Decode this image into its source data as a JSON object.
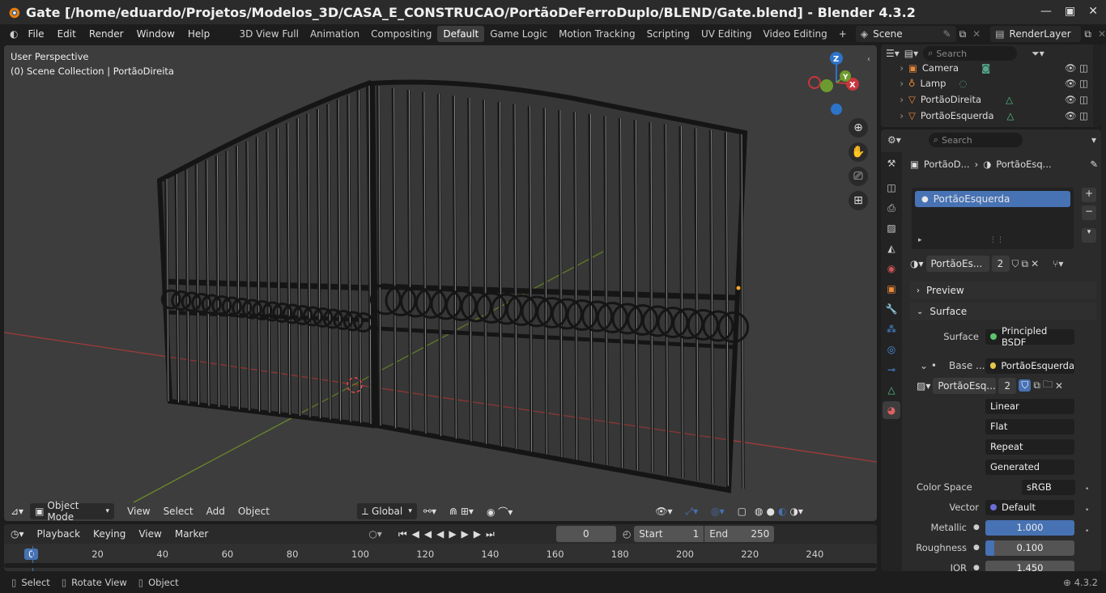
{
  "window": {
    "title": "Gate [/home/eduardo/Projetos/Modelos_3D/CASA_E_CONSTRUCAO/PortãoDeFerroDuplo/BLEND/Gate.blend] - Blender 4.3.2"
  },
  "menus": [
    "File",
    "Edit",
    "Render",
    "Window",
    "Help"
  ],
  "workspaces": [
    "3D View Full",
    "Animation",
    "Compositing",
    "Default",
    "Game Logic",
    "Motion Tracking",
    "Scripting",
    "UV Editing",
    "Video Editing"
  ],
  "active_workspace": "Default",
  "scene": {
    "name": "Scene",
    "render_layer": "RenderLayer"
  },
  "viewport": {
    "perspective": "User Perspective",
    "collection": "(0) Scene Collection | PortãoDireita",
    "gizmo_axes": {
      "x": "X",
      "y": "Y",
      "z": "Z"
    }
  },
  "viewport_header": {
    "mode": "Object Mode",
    "menus": [
      "View",
      "Select",
      "Add",
      "Object"
    ],
    "orientation": "Global"
  },
  "timeline": {
    "menus": [
      "Playback",
      "Keying",
      "View",
      "Marker"
    ],
    "current_frame": "0",
    "start_label": "Start",
    "start": "1",
    "end_label": "End",
    "end": "250",
    "ticks": [
      "0",
      "20",
      "40",
      "60",
      "80",
      "100",
      "120",
      "140",
      "160",
      "180",
      "200",
      "220",
      "240"
    ]
  },
  "status": {
    "select": "Select",
    "rotate": "Rotate View",
    "object": "Object",
    "version": "4.3.2"
  },
  "outliner": {
    "search_placeholder": "Search",
    "items": [
      {
        "name": "Camera"
      },
      {
        "name": "Lamp"
      },
      {
        "name": "PortãoDireita"
      },
      {
        "name": "PortãoEsquerda"
      }
    ]
  },
  "properties": {
    "search_placeholder": "Search",
    "breadcrumb_object": "PortãoD...",
    "breadcrumb_material": "PortãoEsq...",
    "material_slot": "PortãoEsquerda",
    "material_name": "PortãoEs...",
    "material_users": "2",
    "panels": {
      "preview": "Preview",
      "surface": "Surface"
    },
    "surface_label": "Surface",
    "surface_value": "Principled BSDF",
    "base_label": "Base ...",
    "base_value": "PortãoEsquerda",
    "image_name": "PortãoEsq...",
    "image_users": "2",
    "interpolation": "Linear",
    "projection": "Flat",
    "extension": "Repeat",
    "source": "Generated",
    "color_space_label": "Color Space",
    "color_space": "sRGB",
    "vector_label": "Vector",
    "vector_value": "Default",
    "metallic_label": "Metallic",
    "metallic": "1.000",
    "roughness_label": "Roughness",
    "roughness": "0.100",
    "ior_label": "IOR",
    "ior": "1.450"
  },
  "colors": {
    "accent": "#4772b3",
    "x_axis": "#c8363d",
    "y_axis": "#6d9a2e",
    "z_axis": "#2d73c8"
  }
}
